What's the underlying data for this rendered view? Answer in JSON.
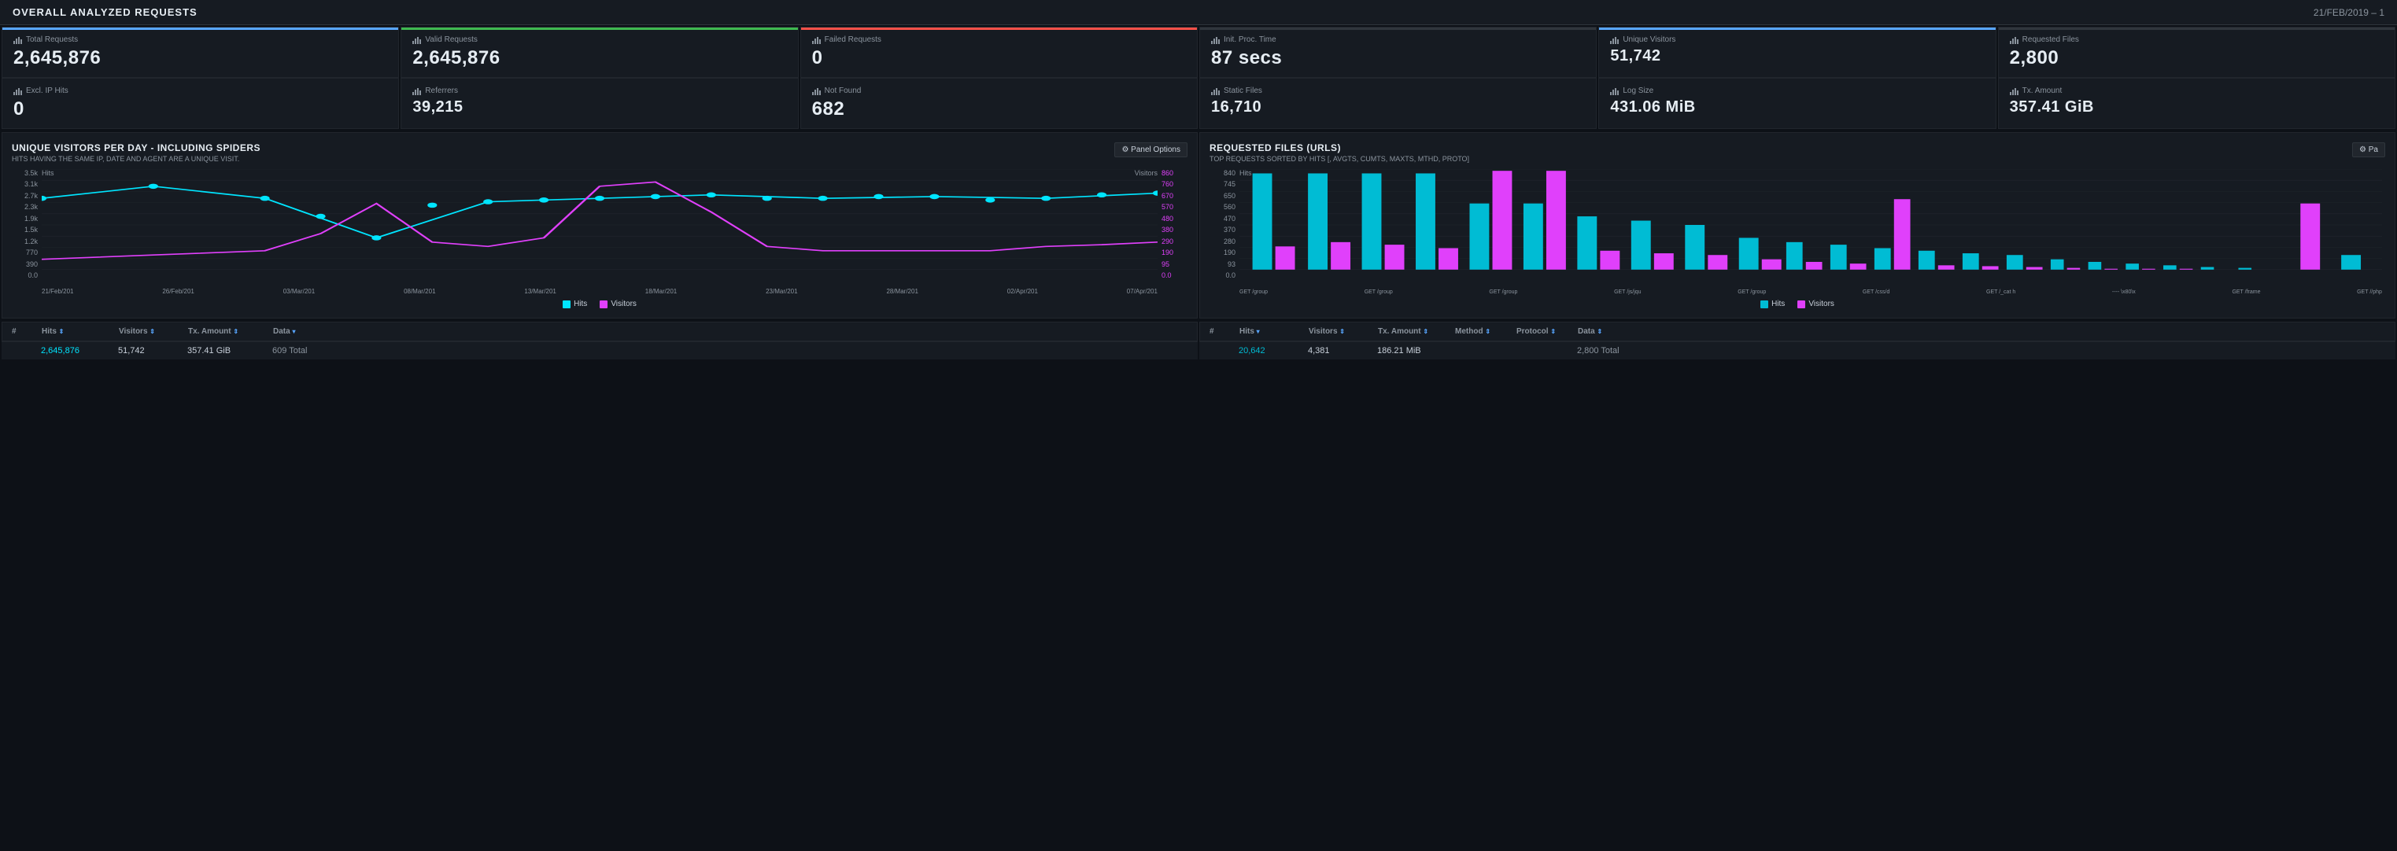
{
  "header": {
    "title": "OVERALL ANALYZED REQUESTS",
    "date": "21/FEB/2019 – 1"
  },
  "metrics": [
    {
      "label": "Total Requests",
      "value": "2,645,876",
      "bar_color": "#58a6ff",
      "row": 1
    },
    {
      "label": "Valid Requests",
      "value": "2,645,876",
      "bar_color": "#3fb950",
      "row": 1
    },
    {
      "label": "Failed Requests",
      "value": "0",
      "bar_color": "#f85149",
      "row": 1
    },
    {
      "label": "Init. Proc. Time",
      "value": "87 secs",
      "bar_color": "#161b22",
      "row": 1
    },
    {
      "label": "Unique Visitors",
      "value": "51,742",
      "bar_color": "#58a6ff",
      "row": 1
    },
    {
      "label": "Requested Files",
      "value": "2,800",
      "bar_color": "#161b22",
      "row": 1
    },
    {
      "label": "Excl. IP Hits",
      "value": "0",
      "bar_color": "#161b22",
      "row": 2
    },
    {
      "label": "Referrers",
      "value": "39,215",
      "bar_color": "#161b22",
      "row": 2
    },
    {
      "label": "Not Found",
      "value": "682",
      "bar_color": "#161b22",
      "row": 2
    },
    {
      "label": "Static Files",
      "value": "16,710",
      "bar_color": "#161b22",
      "row": 2
    },
    {
      "label": "Log Size",
      "value": "431.06 MiB",
      "bar_color": "#161b22",
      "row": 2
    },
    {
      "label": "Tx. Amount",
      "value": "357.41 GiB",
      "bar_color": "#161b22",
      "row": 2
    }
  ],
  "visitors_chart": {
    "title": "UNIQUE VISITORS PER DAY - INCLUDING SPIDERS",
    "subtitle": "HITS HAVING THE SAME IP, DATE AND AGENT ARE A UNIQUE VISIT.",
    "panel_options": "⚙ Panel Options",
    "hits_label": "Hits",
    "visitors_label": "Visitors",
    "y_left": [
      "3.5k",
      "3.1k",
      "2.7k",
      "2.3k",
      "1.9k",
      "1.5k",
      "1.2k",
      "770",
      "390",
      "0.0"
    ],
    "y_right": [
      "860",
      "760",
      "670",
      "570",
      "480",
      "380",
      "290",
      "190",
      "95",
      "0.0"
    ],
    "x_labels": [
      "21/Feb/201",
      "26/Feb/201",
      "03/Mar/201",
      "08/Mar/201",
      "13/Mar/201",
      "18/Mar/201",
      "23/Mar/201",
      "28/Mar/201",
      "02/Apr/201",
      "07/Apr/201"
    ],
    "legend": [
      {
        "label": "Hits",
        "color": "#00e5ff"
      },
      {
        "label": "Visitors",
        "color": "#e040fb"
      }
    ]
  },
  "files_chart": {
    "title": "REQUESTED FILES (URLS)",
    "subtitle": "TOP REQUESTS SORTED BY HITS [, AVGTS, CUMTS, MAXTS, MTHD, PROTO]",
    "panel_options": "⚙ Pa",
    "hits_label": "Hits",
    "y_left": [
      "840",
      "745",
      "650",
      "560",
      "470",
      "370",
      "280",
      "190",
      "93",
      "0.0"
    ],
    "x_labels": [
      "GET /group",
      "GET /group",
      "GET /group",
      "GET /js/jqu",
      "GET /group",
      "GET /css/d",
      "GET /_cat h",
      "------ \\x80\\x",
      "GET /frame",
      "GET //php"
    ],
    "legend": [
      {
        "label": "Hits",
        "color": "#00bcd4"
      },
      {
        "label": "Visitors",
        "color": "#e040fb"
      }
    ]
  },
  "visitors_table": {
    "columns": [
      "#",
      "Hits ↕",
      "Visitors ↕",
      "Tx. Amount ↕",
      "Data ↕"
    ],
    "row": {
      "hash": "",
      "hits": "2,645,876",
      "visitors": "51,742",
      "tx": "357.41 GiB",
      "data": "609 Total"
    }
  },
  "files_table": {
    "columns": [
      "#",
      "Hits ▾",
      "Visitors ↕",
      "Tx. Amount ↕",
      "Method ↕",
      "Protocol ↕",
      "Data ↕"
    ],
    "row": {
      "hash": "",
      "hits": "20,642",
      "visitors": "4,381",
      "tx": "186.21 MiB",
      "method": "",
      "protocol": "",
      "data": "2,800 Total"
    }
  }
}
